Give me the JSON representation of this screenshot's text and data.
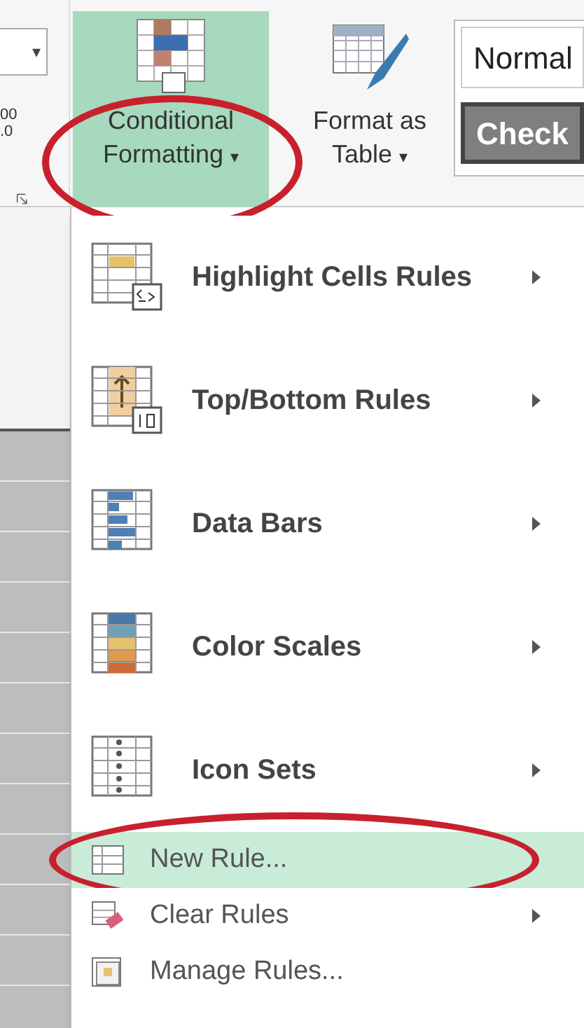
{
  "ribbon": {
    "dropdown_caret": "▾",
    "decimal_icon_text": [
      "00",
      ".0"
    ],
    "conditional_formatting": {
      "label": "Conditional",
      "label_line2": "Formatting",
      "caret": "▾",
      "selected": true,
      "circled": true
    },
    "format_as_table": {
      "label": "Format as",
      "label_line2": "Table",
      "caret": "▾"
    },
    "styles": [
      {
        "label": "Normal",
        "kind": "normal"
      },
      {
        "label": "Check",
        "kind": "check"
      }
    ]
  },
  "menu": {
    "items": [
      {
        "kind": "large",
        "label": "Highlight Cells Rules",
        "has_submenu": true,
        "selected": false,
        "circled": false
      },
      {
        "kind": "large",
        "label": "Top/Bottom Rules",
        "has_submenu": true,
        "selected": false,
        "circled": false
      },
      {
        "kind": "large",
        "label": "Data Bars",
        "has_submenu": true,
        "selected": false,
        "circled": false
      },
      {
        "kind": "large",
        "label": "Color Scales",
        "has_submenu": true,
        "selected": false,
        "circled": false
      },
      {
        "kind": "large",
        "label": "Icon Sets",
        "has_submenu": true,
        "selected": false,
        "circled": false
      },
      {
        "kind": "small",
        "label": "New Rule...",
        "has_submenu": false,
        "selected": true,
        "circled": true
      },
      {
        "kind": "small",
        "label": "Clear Rules",
        "has_submenu": true,
        "selected": false,
        "circled": false
      },
      {
        "kind": "small",
        "label": "Manage Rules...",
        "has_submenu": false,
        "selected": false,
        "circled": false
      }
    ]
  }
}
